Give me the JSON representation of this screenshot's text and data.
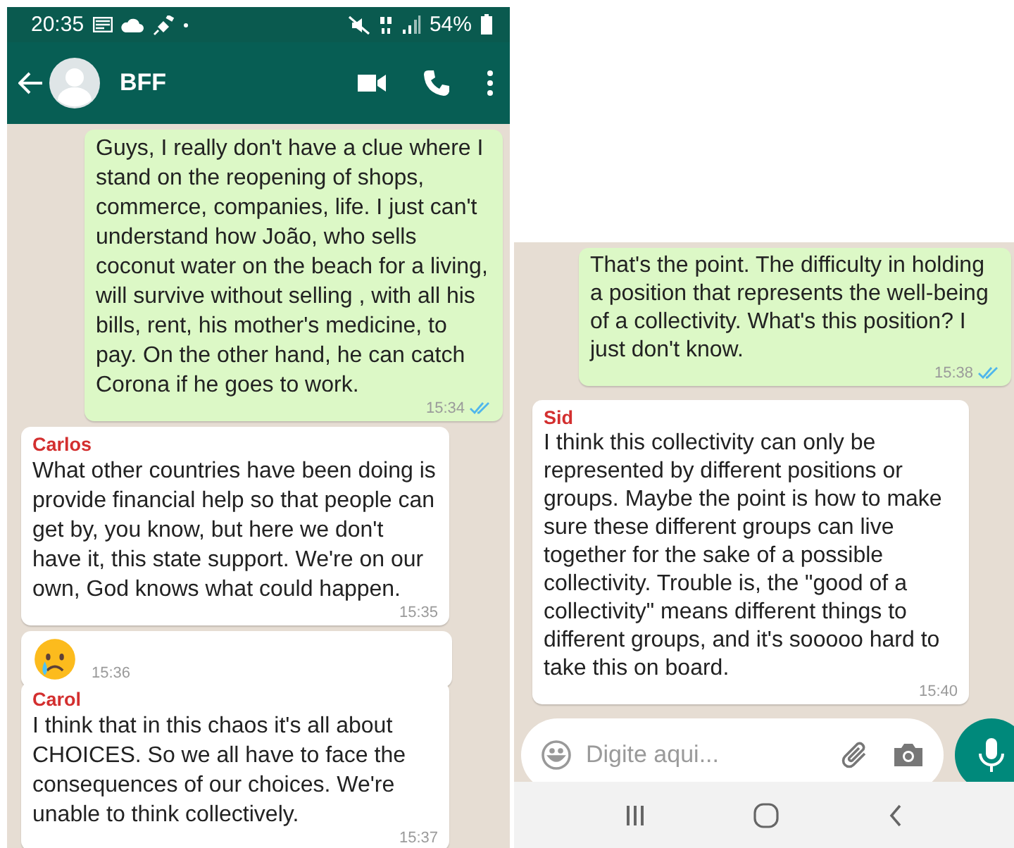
{
  "left_phone": {
    "status_bar": {
      "time": "20:35",
      "battery": "54%"
    },
    "header": {
      "title": "BFF"
    },
    "messages": [
      {
        "kind": "outgoing",
        "text": "Guys, I really don't have a clue where I stand on the reopening of shops, commerce, companies, life. I just can't understand how João, who sells coconut water on the beach for a living, will survive without selling , with all his bills, rent, his mother's medicine, to pay. On the other hand, he can catch Corona if he goes to work.",
        "time": "15:34",
        "read": true
      },
      {
        "kind": "incoming",
        "sender": "Carlos",
        "text": "What other countries have been doing is provide financial help so that people can get by, you know, but here we don't have it, this state support. We're on our own, God knows what could happen.",
        "time": "15:35"
      },
      {
        "kind": "emoji",
        "time": "15:36"
      },
      {
        "kind": "incoming",
        "sender": "Carol",
        "text": "I think that in this chaos it's all about CHOICES. So we all have to face the consequences of our choices. We're unable to think collectively.",
        "time": "15:37"
      }
    ]
  },
  "right_phone": {
    "messages": [
      {
        "kind": "outgoing",
        "text": "That's the point. The difficulty in holding a position that represents the well-being of a collectivity. What's this position? I just don't know.",
        "time": "15:38",
        "read": true
      },
      {
        "kind": "incoming",
        "sender": "Sid",
        "text": "I think this collectivity can only be represented by different positions or groups. Maybe the point is how to make sure these different groups can live together for the sake of a possible collectivity. Trouble is, the \"good of a collectivity\" means different things to different groups, and it's sooooo hard to take this on board.",
        "time": "15:40"
      }
    ],
    "composer": {
      "placeholder": "Digite aqui..."
    }
  }
}
